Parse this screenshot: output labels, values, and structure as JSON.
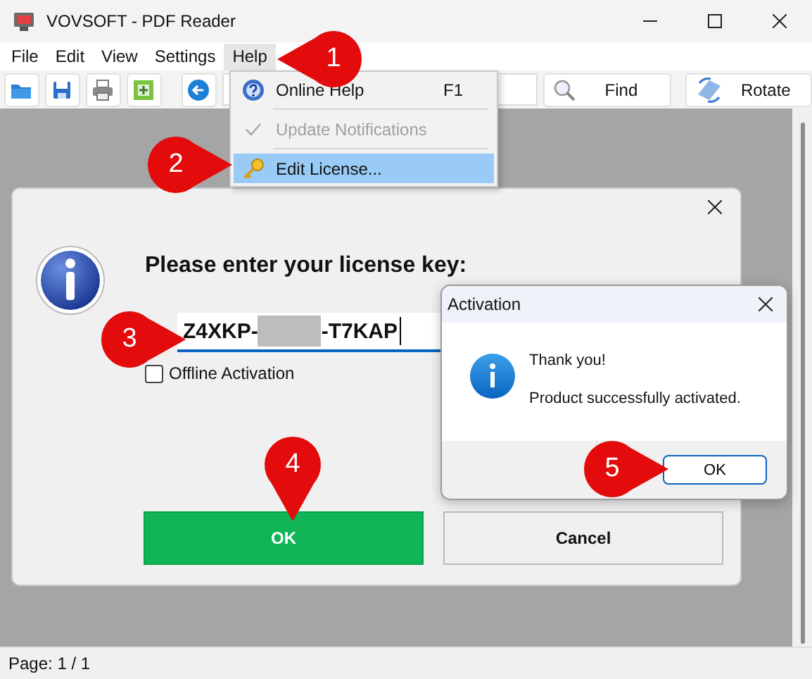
{
  "window": {
    "title": "VOVSOFT - PDF Reader"
  },
  "menu_bar": [
    {
      "label": "File",
      "selected": false
    },
    {
      "label": "Edit",
      "selected": false
    },
    {
      "label": "View",
      "selected": false
    },
    {
      "label": "Settings",
      "selected": false
    },
    {
      "label": "Help",
      "selected": true
    }
  ],
  "toolbar": {
    "buttons": [
      {
        "label": "Find"
      },
      {
        "label": "Rotate"
      }
    ]
  },
  "help_menu": [
    {
      "label": "Online Help",
      "shortcut": "F1",
      "disabled": false,
      "checked": false,
      "highlighted": false
    },
    {
      "label": "Update Notifications",
      "disabled": true,
      "checked": true,
      "highlighted": false
    },
    {
      "label": "Edit License...",
      "disabled": false,
      "checked": false,
      "highlighted": true
    }
  ],
  "license_dialog": {
    "heading": "Please enter your license key:",
    "key_start": "Z4XKP-",
    "key_end": "-T7KAP",
    "offline_activation": {
      "label": "Offline Activation",
      "checked": false
    },
    "buttons": [
      {
        "label": "OK",
        "kind": "primary"
      },
      {
        "label": "Cancel",
        "kind": "secondary"
      }
    ]
  },
  "activation_dialog": {
    "title": "Activation",
    "lines": [
      "Thank you!",
      "Product successfully activated."
    ],
    "button": "OK"
  },
  "callouts": [
    {
      "number": "1"
    },
    {
      "number": "2"
    },
    {
      "number": "3"
    },
    {
      "number": "4"
    },
    {
      "number": "5"
    }
  ],
  "status_bar": {
    "text": "Page: 1 / 1"
  }
}
